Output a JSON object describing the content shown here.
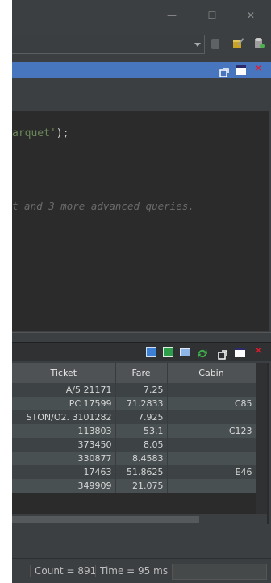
{
  "window_controls": {
    "minimize": "—",
    "maximize": "☐",
    "close": "✕"
  },
  "editor": {
    "code_line_string": "arquet'",
    "code_line_punct": ");",
    "comment": "t and 3 more advanced queries."
  },
  "results": {
    "columns": [
      "Ticket",
      "Fare",
      "Cabin"
    ],
    "rows": [
      {
        "ticket": "A/5 21171",
        "fare": "7.25",
        "cabin": ""
      },
      {
        "ticket": "PC 17599",
        "fare": "71.2833",
        "cabin": "C85"
      },
      {
        "ticket": "STON/O2. 3101282",
        "fare": "7.925",
        "cabin": ""
      },
      {
        "ticket": "113803",
        "fare": "53.1",
        "cabin": "C123"
      },
      {
        "ticket": "373450",
        "fare": "8.05",
        "cabin": ""
      },
      {
        "ticket": "330877",
        "fare": "8.4583",
        "cabin": ""
      },
      {
        "ticket": "17463",
        "fare": "51.8625",
        "cabin": "E46"
      },
      {
        "ticket": "349909",
        "fare": "21.075",
        "cabin": ""
      }
    ]
  },
  "status": {
    "count": "Count = 891",
    "time": "Time = 95 ms"
  },
  "colors": {
    "accent": "#4876be",
    "close_red": "#e8192c",
    "string_green": "#6a8759"
  }
}
